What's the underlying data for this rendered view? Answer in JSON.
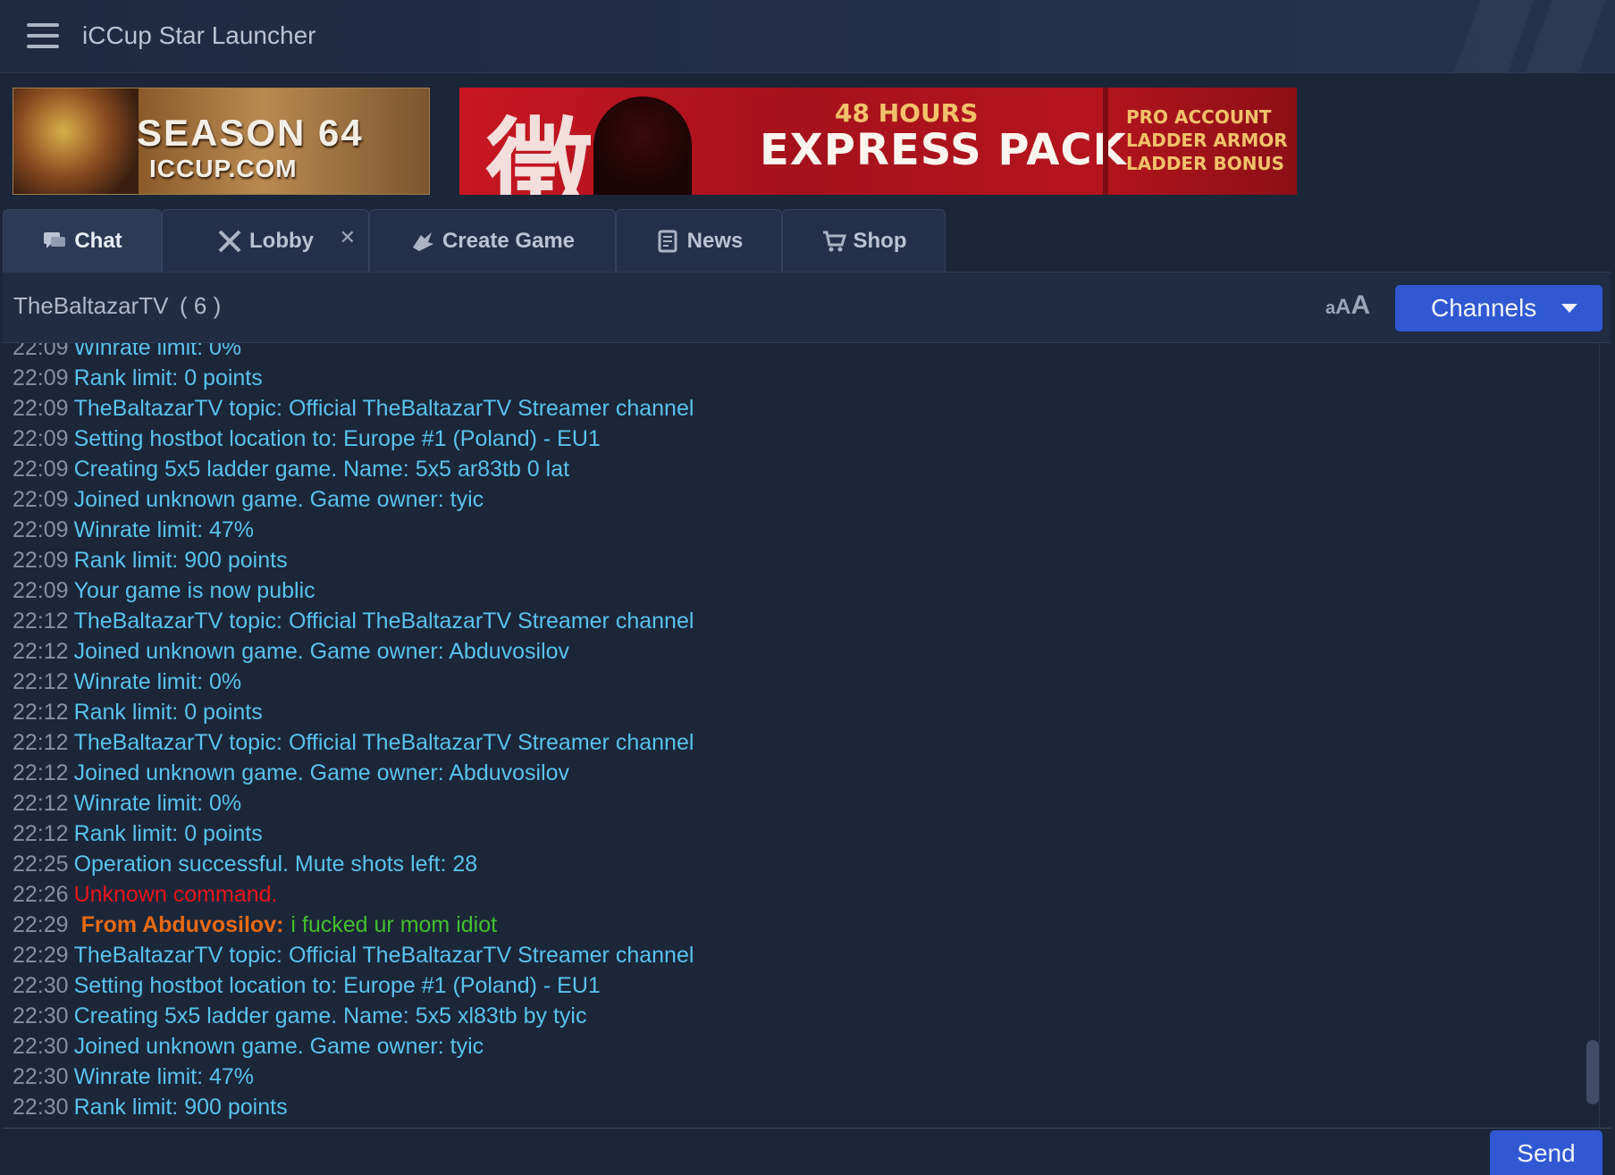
{
  "window": {
    "title": "iCCup Star Launcher"
  },
  "banners": {
    "season": {
      "line1": "SEASON 64",
      "line2": "ICCUP.COM"
    },
    "express": {
      "hours": "48 HOURS",
      "title": "EXPRESS PACK",
      "perks": [
        "PRO ACCOUNT",
        "LADDER ARMOR",
        "LADDER BONUS"
      ]
    }
  },
  "tabs": [
    {
      "label": "Chat",
      "icon": "chat-bubble-icon"
    },
    {
      "label": "Lobby",
      "icon": "crossed-swords-icon"
    },
    {
      "label": "Create Game",
      "icon": "create-game-icon"
    },
    {
      "label": "News",
      "icon": "newspaper-icon"
    },
    {
      "label": "Shop",
      "icon": "cart-icon"
    }
  ],
  "channel": {
    "name": "TheBaltazarTV",
    "count": "( 6 )",
    "font_size_small": "a",
    "font_size_medium": "A",
    "font_size_large": "A",
    "channels_button": "Channels"
  },
  "messages": [
    {
      "time": "22:09",
      "text": "Winrate limit: 0%"
    },
    {
      "time": "22:09",
      "text": "Rank limit: 0 points"
    },
    {
      "time": "22:09",
      "text": "TheBaltazarTV topic: Official TheBaltazarTV Streamer channel"
    },
    {
      "time": "22:09",
      "text": "Setting hostbot location to: Europe #1 (Poland) - EU1"
    },
    {
      "time": "22:09",
      "text": "Creating 5x5 ladder game. Name: 5x5 ar83tb 0 lat"
    },
    {
      "time": "22:09",
      "text": "Joined unknown game. Game owner: tyic"
    },
    {
      "time": "22:09",
      "text": "Winrate limit: 47%"
    },
    {
      "time": "22:09",
      "text": "Rank limit: 900 points"
    },
    {
      "time": "22:09",
      "text": "Your game is now public"
    },
    {
      "time": "22:12",
      "text": "TheBaltazarTV topic: Official TheBaltazarTV Streamer channel"
    },
    {
      "time": "22:12",
      "text": "Joined unknown game. Game owner: Abduvosilov"
    },
    {
      "time": "22:12",
      "text": "Winrate limit: 0%"
    },
    {
      "time": "22:12",
      "text": "Rank limit: 0 points"
    },
    {
      "time": "22:12",
      "text": "TheBaltazarTV topic: Official TheBaltazarTV Streamer channel"
    },
    {
      "time": "22:12",
      "text": "Joined unknown game. Game owner: Abduvosilov"
    },
    {
      "time": "22:12",
      "text": "Winrate limit: 0%"
    },
    {
      "time": "22:12",
      "text": "Rank limit: 0 points"
    },
    {
      "time": "22:25",
      "text": "Operation successful. Mute shots left: 28"
    },
    {
      "time": "22:26",
      "text": "Unknown command.",
      "type": "error"
    },
    {
      "time": "22:29",
      "sender": "From Abduvosilov:",
      "text": "i fucked ur mom idiot",
      "type": "whisper"
    },
    {
      "time": "22:29",
      "text": "TheBaltazarTV topic: Official TheBaltazarTV Streamer channel"
    },
    {
      "time": "22:30",
      "text": "Setting hostbot location to: Europe #1 (Poland) - EU1"
    },
    {
      "time": "22:30",
      "text": "Creating 5x5 ladder game. Name: 5x5 xl83tb by tyic"
    },
    {
      "time": "22:30",
      "text": "Joined unknown game. Game owner: tyic"
    },
    {
      "time": "22:30",
      "text": "Winrate limit: 47%"
    },
    {
      "time": "22:30",
      "text": "Rank limit: 900 points"
    }
  ],
  "input": {
    "value": "",
    "placeholder": ""
  },
  "send_button": "Send",
  "colors": {
    "background": "#1b2639",
    "system_text": "#59c3ee",
    "timestamp": "#8591a3",
    "error": "#e8161c",
    "whisper_sender": "#e86a12",
    "whisper_text": "#43c02c",
    "accent_button": "#2f58d2"
  }
}
